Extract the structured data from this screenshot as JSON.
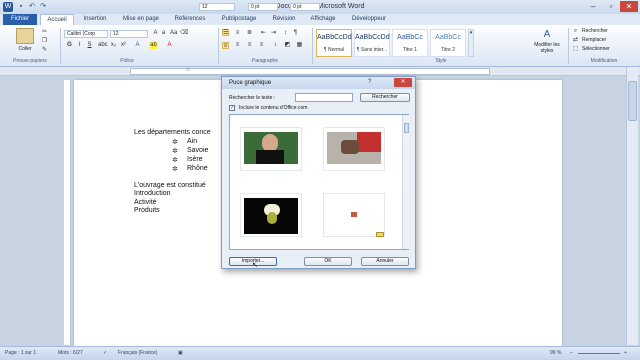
{
  "window": {
    "title": "Document1 - Microsoft Word",
    "zoom_box_1": "12",
    "spacing_before": "0 pt",
    "spacing_after": "0 pt"
  },
  "tabs": [
    "Fichier",
    "Accueil",
    "Insertion",
    "Mise en page",
    "Références",
    "Publipostage",
    "Révision",
    "Affichage",
    "Développeur"
  ],
  "ribbon": {
    "clipboard": {
      "paste": "Coller",
      "label": "Presse-papiers"
    },
    "font": {
      "name": "Calibri (Corp",
      "size": "12",
      "label": "Police"
    },
    "paragraph": {
      "label": "Paragraphe"
    },
    "styles": {
      "label": "Style",
      "items": [
        {
          "sample": "AaBbCcDd",
          "name": "¶ Normal"
        },
        {
          "sample": "AaBbCcDd",
          "name": "¶ Sans inter..."
        },
        {
          "sample": "AaBbCc",
          "name": "Titre 1"
        },
        {
          "sample": "AaBbCc",
          "name": "Titre 2"
        }
      ],
      "change": "Modifier les styles"
    },
    "editing": {
      "find": "Rechercher",
      "replace": "Remplacer",
      "select": "Sélectionner",
      "label": "Modification"
    }
  },
  "document": {
    "line1": "Les départements  conce",
    "bullets": [
      "Ain",
      "Savoie",
      "Isère",
      "Rhône"
    ],
    "line2": "L'ouvrage est constitué",
    "lines": [
      "Introduction",
      "Activité",
      "Produits"
    ]
  },
  "dialog": {
    "title": "Puce graphique",
    "search_label": "Rechercher le texte :",
    "search_value": "",
    "search_button": "Rechercher",
    "include_label": "Inclure le contenu d'Office.com",
    "import_button": "Importer...",
    "ok_button": "OK",
    "cancel_button": "Annuler"
  },
  "status": {
    "page": "Page : 1 sur 1",
    "words": "Mots : 6/27",
    "language": "Français (France)",
    "zoom": "99 %"
  },
  "colors": {
    "accent": "#2a5ea8",
    "ribbon_bg": "#dbe6f4",
    "frame": "#c8d3e2"
  }
}
